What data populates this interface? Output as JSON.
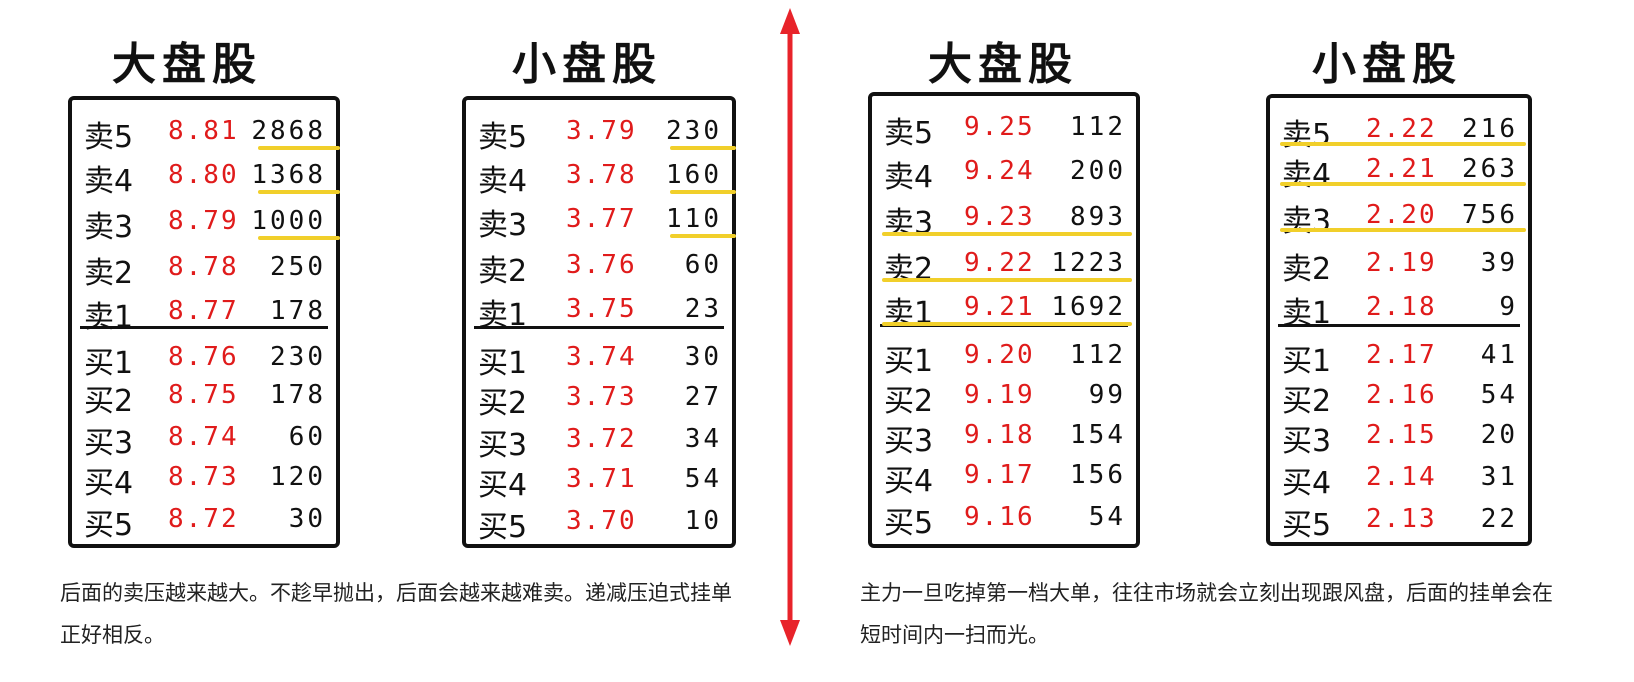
{
  "panels": [
    {
      "title": "大盘股",
      "asks": [
        {
          "label": "卖5",
          "price": "8.81",
          "volume": "2868"
        },
        {
          "label": "卖4",
          "price": "8.80",
          "volume": "1368"
        },
        {
          "label": "卖3",
          "price": "8.79",
          "volume": "1000"
        },
        {
          "label": "卖2",
          "price": "8.78",
          "volume": "250"
        },
        {
          "label": "卖1",
          "price": "8.77",
          "volume": "178"
        }
      ],
      "bids": [
        {
          "label": "买1",
          "price": "8.76",
          "volume": "230"
        },
        {
          "label": "买2",
          "price": "8.75",
          "volume": "178"
        },
        {
          "label": "买3",
          "price": "8.74",
          "volume": "60"
        },
        {
          "label": "买4",
          "price": "8.73",
          "volume": "120"
        },
        {
          "label": "买5",
          "price": "8.72",
          "volume": "30"
        }
      ]
    },
    {
      "title": "小盘股",
      "asks": [
        {
          "label": "卖5",
          "price": "3.79",
          "volume": "230"
        },
        {
          "label": "卖4",
          "price": "3.78",
          "volume": "160"
        },
        {
          "label": "卖3",
          "price": "3.77",
          "volume": "110"
        },
        {
          "label": "卖2",
          "price": "3.76",
          "volume": "60"
        },
        {
          "label": "卖1",
          "price": "3.75",
          "volume": "23"
        }
      ],
      "bids": [
        {
          "label": "买1",
          "price": "3.74",
          "volume": "30"
        },
        {
          "label": "买2",
          "price": "3.73",
          "volume": "27"
        },
        {
          "label": "买3",
          "price": "3.72",
          "volume": "34"
        },
        {
          "label": "买4",
          "price": "3.71",
          "volume": "54"
        },
        {
          "label": "买5",
          "price": "3.70",
          "volume": "10"
        }
      ]
    },
    {
      "title": "大盘股",
      "asks": [
        {
          "label": "卖5",
          "price": "9.25",
          "volume": "112"
        },
        {
          "label": "卖4",
          "price": "9.24",
          "volume": "200"
        },
        {
          "label": "卖3",
          "price": "9.23",
          "volume": "893"
        },
        {
          "label": "卖2",
          "price": "9.22",
          "volume": "1223"
        },
        {
          "label": "卖1",
          "price": "9.21",
          "volume": "1692"
        }
      ],
      "bids": [
        {
          "label": "买1",
          "price": "9.20",
          "volume": "112"
        },
        {
          "label": "买2",
          "price": "9.19",
          "volume": "99"
        },
        {
          "label": "买3",
          "price": "9.18",
          "volume": "154"
        },
        {
          "label": "买4",
          "price": "9.17",
          "volume": "156"
        },
        {
          "label": "买5",
          "price": "9.16",
          "volume": "54"
        }
      ]
    },
    {
      "title": "小盘股",
      "asks": [
        {
          "label": "卖5",
          "price": "2.22",
          "volume": "216"
        },
        {
          "label": "卖4",
          "price": "2.21",
          "volume": "263"
        },
        {
          "label": "卖3",
          "price": "2.20",
          "volume": "756"
        },
        {
          "label": "卖2",
          "price": "2.19",
          "volume": "39"
        },
        {
          "label": "卖1",
          "price": "2.18",
          "volume": "9"
        }
      ],
      "bids": [
        {
          "label": "买1",
          "price": "2.17",
          "volume": "41"
        },
        {
          "label": "买2",
          "price": "2.16",
          "volume": "54"
        },
        {
          "label": "买3",
          "price": "2.15",
          "volume": "20"
        },
        {
          "label": "买4",
          "price": "2.14",
          "volume": "31"
        },
        {
          "label": "买5",
          "price": "2.13",
          "volume": "22"
        }
      ]
    }
  ],
  "captions": {
    "left": "后面的卖压越来越大。不趁早抛出，后面会越来越难卖。递减压迫式挂单正好相反。",
    "right": "主力一旦吃掉第一档大单，往往市场就会立刻出现跟风盘，后面的挂单会在短时间内一扫而光。"
  },
  "colors": {
    "price": "#e01b1b",
    "highlight": "#f1cf2a",
    "divider_arrow": "#e8232a",
    "ink": "#111111"
  }
}
